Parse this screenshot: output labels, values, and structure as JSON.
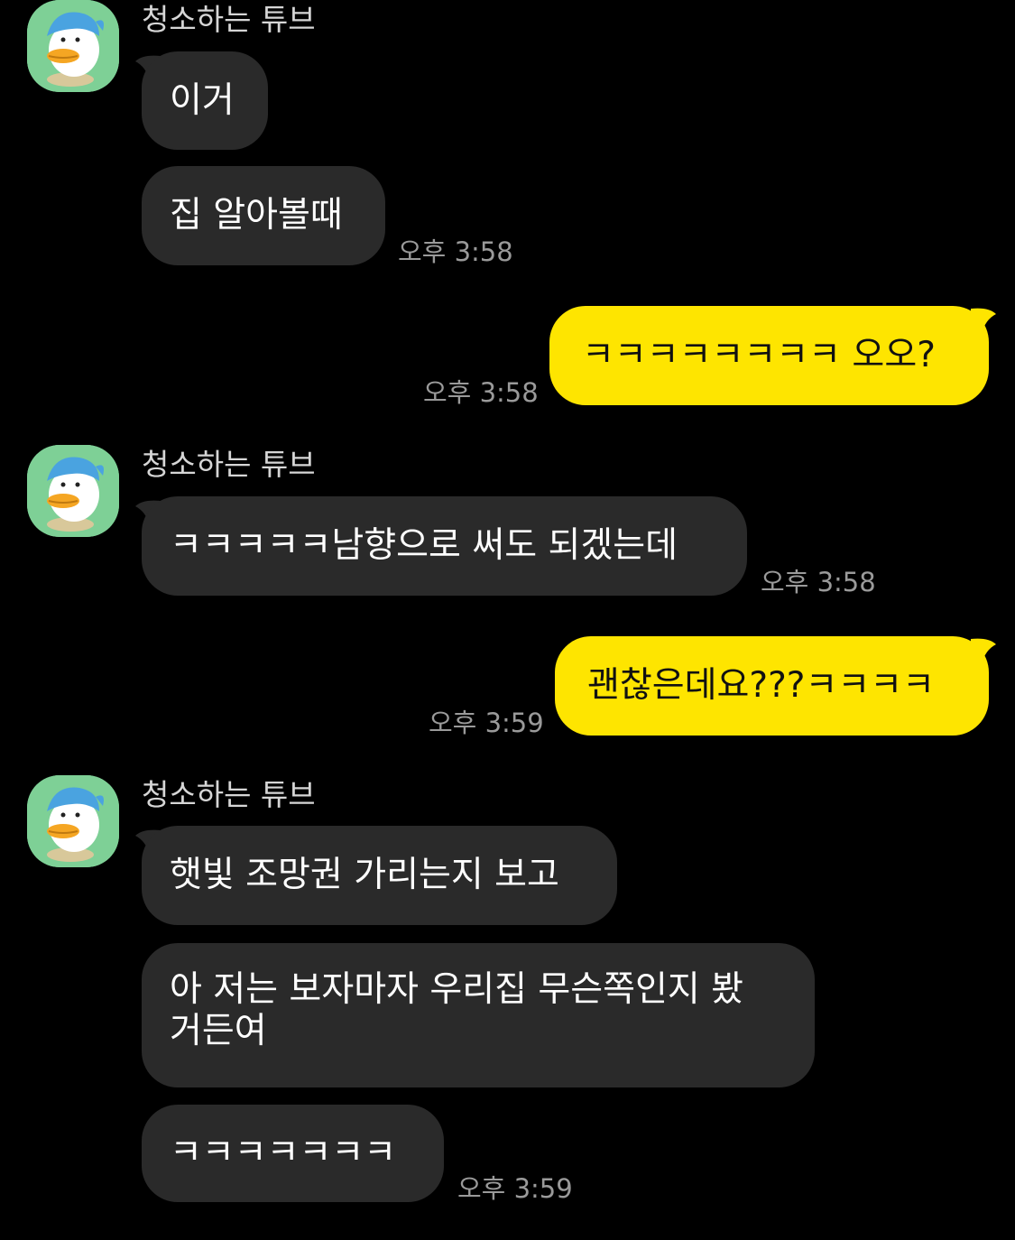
{
  "chat": {
    "sender_name": "청소하는 튜브",
    "avatar_icon": "tube-duck-character-icon",
    "colors": {
      "background": "#000000",
      "incoming_bubble": "#2a2a2a",
      "outgoing_bubble": "#fee500",
      "avatar_bg": "#7ed096"
    },
    "messages": [
      {
        "id": "m1",
        "direction": "incoming",
        "text": "이거"
      },
      {
        "id": "m2",
        "direction": "incoming",
        "text": "집 알아볼때",
        "time": "오후 3:58"
      },
      {
        "id": "m3",
        "direction": "outgoing",
        "text": "ㅋㅋㅋㅋㅋㅋㅋㅋ 오오?",
        "time": "오후 3:58"
      },
      {
        "id": "m4",
        "direction": "incoming",
        "text": "ㅋㅋㅋㅋㅋ남향으로 써도 되겠는데",
        "time": "오후 3:58"
      },
      {
        "id": "m5",
        "direction": "outgoing",
        "text": "괜찮은데요???ㅋㅋㅋㅋ",
        "time": "오후 3:59"
      },
      {
        "id": "m6",
        "direction": "incoming",
        "text": "햇빛 조망권 가리는지 보고"
      },
      {
        "id": "m7",
        "direction": "incoming",
        "text_line1": "아 저는 보자마자 우리집 무슨쪽인지 봤",
        "text_line2": "거든여"
      },
      {
        "id": "m8",
        "direction": "incoming",
        "text": "ㅋㅋㅋㅋㅋㅋㅋ",
        "time": "오후 3:59"
      }
    ]
  }
}
